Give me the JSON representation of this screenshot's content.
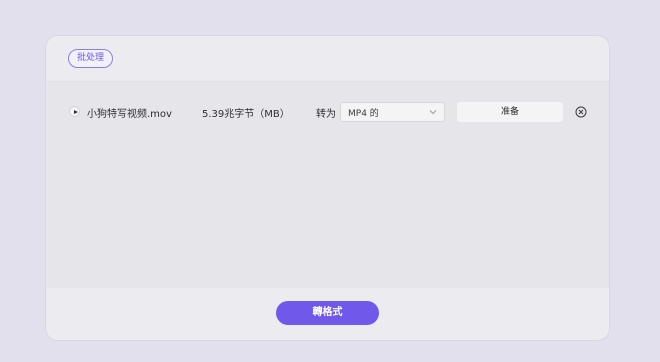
{
  "header": {
    "batch_label": "批处理"
  },
  "files": [
    {
      "name": "小狗特写视频.mov",
      "size": "5.39兆字节（MB）",
      "convert_to_label": "转为",
      "format": "MP4 的",
      "status": "准备"
    }
  ],
  "footer": {
    "convert_label": "轉格式"
  },
  "colors": {
    "accent": "#6f58ea",
    "page_background": "#e2e0ed",
    "card_background": "#ececf0",
    "body_background": "#e5e5ea"
  },
  "icons": {
    "play": "play-icon",
    "chevron": "chevron-down-icon",
    "remove": "close-circle-icon"
  }
}
